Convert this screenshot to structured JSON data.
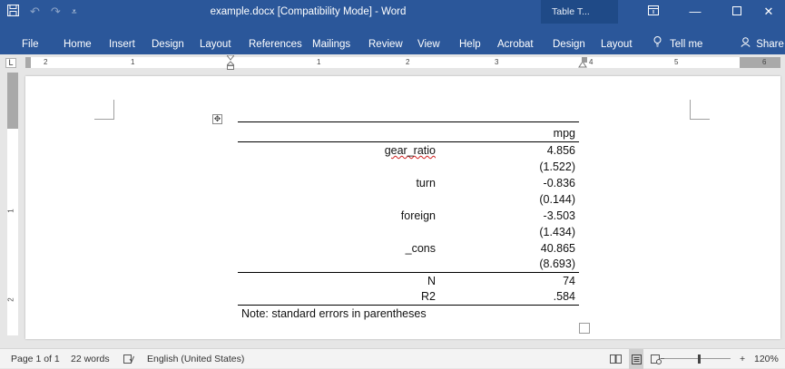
{
  "titlebar": {
    "doc_title": "example.docx [Compatibility Mode]  -  Word",
    "context_tab": "Table T...",
    "save_icon": "save-icon",
    "undo_icon": "undo-icon",
    "redo_icon": "redo-icon",
    "qat_menu_icon": "customize-qat-icon",
    "ribbon_display_icon": "ribbon-display-options-icon",
    "minimize_icon": "minimize-icon",
    "maximize_icon": "maximize-icon",
    "close_icon": "close-icon"
  },
  "ribbon": {
    "tabs": [
      "File",
      "Home",
      "Insert",
      "Design",
      "Layout",
      "References",
      "Mailings",
      "Review",
      "View",
      "Help",
      "Acrobat",
      "Design",
      "Layout"
    ],
    "tellme": "Tell me",
    "share": "Share"
  },
  "ruler": {
    "numbers": [
      "2",
      "1",
      "1",
      "2",
      "3",
      "4",
      "5",
      "6"
    ]
  },
  "vruler": {
    "numbers": [
      "1",
      "2"
    ]
  },
  "table": {
    "header": "mpg",
    "rows": [
      {
        "label": "gear_ratio",
        "value": "4.856"
      },
      {
        "label": "",
        "value": "(1.522)"
      },
      {
        "label": "turn",
        "value": "-0.836"
      },
      {
        "label": "",
        "value": "(0.144)"
      },
      {
        "label": "foreign",
        "value": "-3.503"
      },
      {
        "label": "",
        "value": "(1.434)"
      },
      {
        "label": "_cons",
        "value": "40.865"
      },
      {
        "label": "",
        "value": "(8.693)"
      }
    ],
    "stats": [
      {
        "label": "N",
        "value": "74"
      },
      {
        "label": "R2",
        "value": ".584"
      }
    ],
    "note": "Note: standard errors in parentheses"
  },
  "statusbar": {
    "page": "Page 1 of 1",
    "words": "22 words",
    "language": "English (United States)",
    "zoom": "120%",
    "zoom_out": "−",
    "zoom_in": "+"
  },
  "colors": {
    "word_blue": "#2b579a",
    "context_tab": "#1f4a87"
  }
}
